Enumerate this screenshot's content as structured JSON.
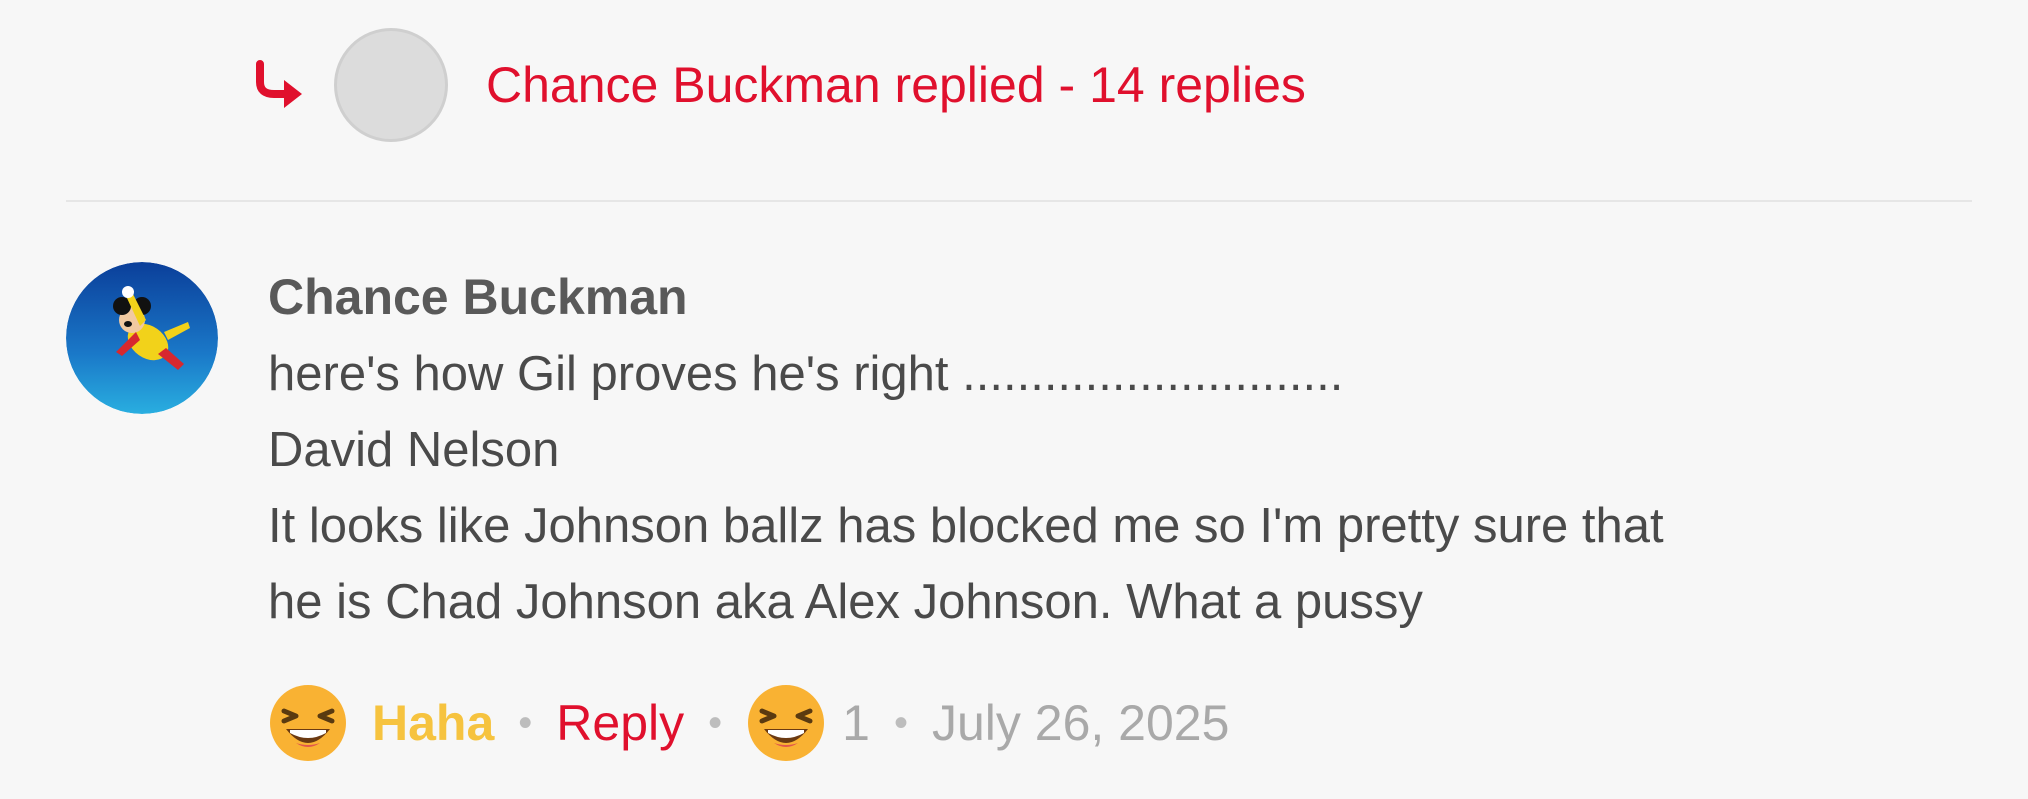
{
  "thread": {
    "reply_summary": "Chance Buckman replied - 14 replies"
  },
  "comment": {
    "author": "Chance Buckman",
    "lines": [
      "here's how Gil proves he's right ............................",
      "David Nelson",
      "It looks like Johnson ballz has blocked me so I'm pretty sure that",
      "he is Chad Johnson aka Alex Johnson. What a pussy"
    ],
    "actions": {
      "reaction_label": "Haha",
      "reply_label": "Reply",
      "reaction_count": "1",
      "date": "July 26, 2025"
    }
  },
  "colors": {
    "accent": "#e0102d",
    "haha": "#f6c33f",
    "muted": "#a9a9a9",
    "background": "#f7f7f7"
  },
  "icons": {
    "reply_arrow": "reply-arrow-icon",
    "reaction": "laughing-emoji-icon"
  }
}
